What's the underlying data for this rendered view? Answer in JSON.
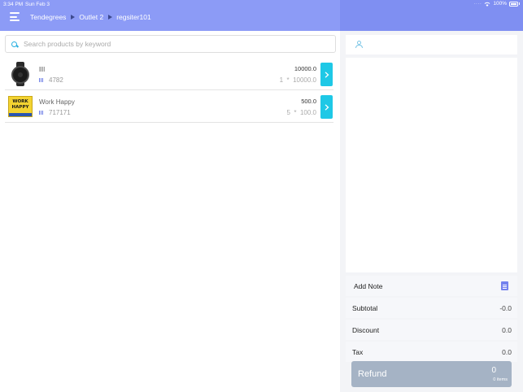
{
  "status_bar": {
    "time": "3:34 PM",
    "date": "Sun Feb 3",
    "battery": "100%"
  },
  "header": {
    "breadcrumb": [
      "Tendegrees",
      "Outlet 2",
      "regsiter101"
    ]
  },
  "search": {
    "placeholder": "Search products by keyword",
    "value": ""
  },
  "products": [
    {
      "name": "llll",
      "code": "4782",
      "price": "10000.0",
      "qty": "1",
      "unit_price": "10000.0",
      "image": "wristwatch"
    },
    {
      "name": "Work Happy",
      "code": "717171",
      "price": "500.0",
      "qty": "5",
      "unit_price": "100.0",
      "image": "work-happy-sign",
      "image_text": [
        "WORK",
        "HAPPY"
      ]
    }
  ],
  "cart": {
    "add_note_label": "Add Note",
    "subtotal_label": "Subtotal",
    "subtotal_value": "-0.0",
    "discount_label": "Discount",
    "discount_value": "0.0",
    "tax_label": "Tax",
    "tax_value": "0.0"
  },
  "refund": {
    "label": "Refund",
    "total": "0",
    "items": "0 items"
  },
  "colors": {
    "header": "#8c9bf6",
    "header_right": "#7f8ff2",
    "accent": "#1ec8e6",
    "refund_button": "#a5b3c5"
  }
}
